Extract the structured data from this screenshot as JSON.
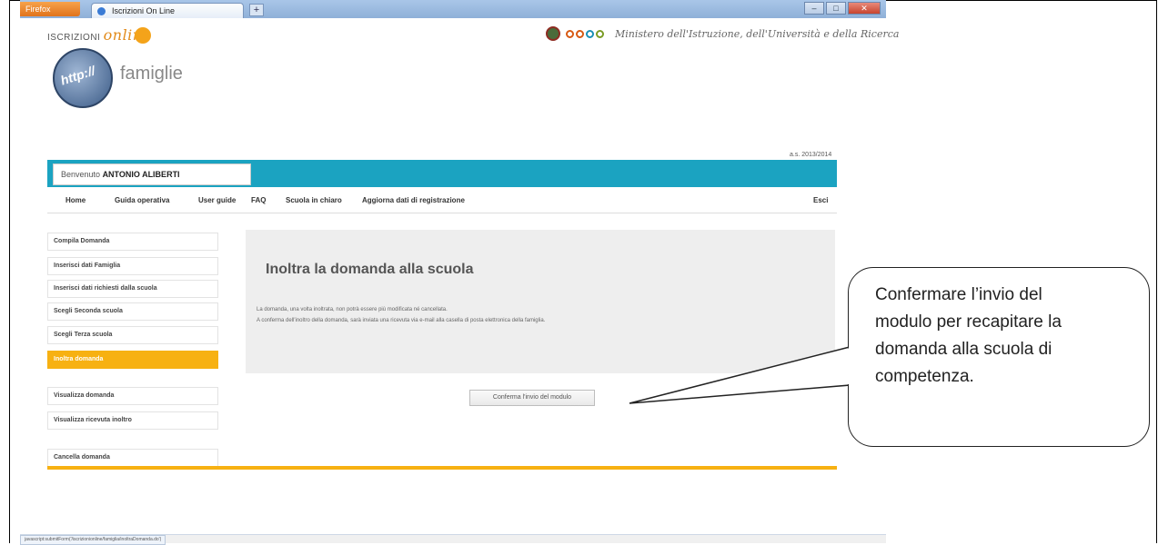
{
  "browser": {
    "app_button": "Firefox",
    "tab_title": "Iscrizioni On Line",
    "new_tab": "+"
  },
  "header": {
    "logo_prefix": "ISCRIZIONI",
    "logo_online": "online",
    "http_badge": "http://",
    "section": "famiglie",
    "ministry": "Ministero dell'Istruzione, dell'Università e della Ricerca",
    "year": "a.s. 2013/2014"
  },
  "welcome": {
    "prefix": "Benvenuto",
    "user": "ANTONIO ALIBERTI"
  },
  "menu": {
    "home": "Home",
    "guida": "Guida operativa",
    "user_guide": "User guide",
    "faq": "FAQ",
    "scuola_in_chiaro": "Scuola in chiaro",
    "aggiorna": "Aggiorna dati di registrazione",
    "esci": "Esci"
  },
  "sidebar": {
    "items": [
      "Compila Domanda",
      "Inserisci dati Famiglia",
      "Inserisci dati richiesti dalla scuola",
      "Scegli Seconda scuola",
      "Scegli Terza scuola",
      "Inoltra domanda",
      "Visualizza domanda",
      "Visualizza ricevuta inoltro",
      "Cancella domanda"
    ],
    "active_index": 5
  },
  "content": {
    "title": "Inoltra la domanda alla scuola",
    "line1": "La domanda, una volta inoltrata, non potrà essere più modificata né cancellata.",
    "line2": "A conferma dell'inoltro della domanda, sarà inviata una ricevuta via e-mail alla casella di posta elettronica della famiglia.",
    "confirm_button": "Conferma l'invio del modulo"
  },
  "statusbar": {
    "url": "javascript:submitForm('/iscrizionionline/famiglia/inoltraDomanda.do')"
  },
  "callout": {
    "line1": "Confermare l’invio del",
    "line2": "modulo per recapitare la",
    "line3": "domanda alla scuola di",
    "line4": "competenza."
  },
  "colors": {
    "teal": "#1ba3c1",
    "orange": "#f7b112",
    "panel": "#eeeeee"
  }
}
